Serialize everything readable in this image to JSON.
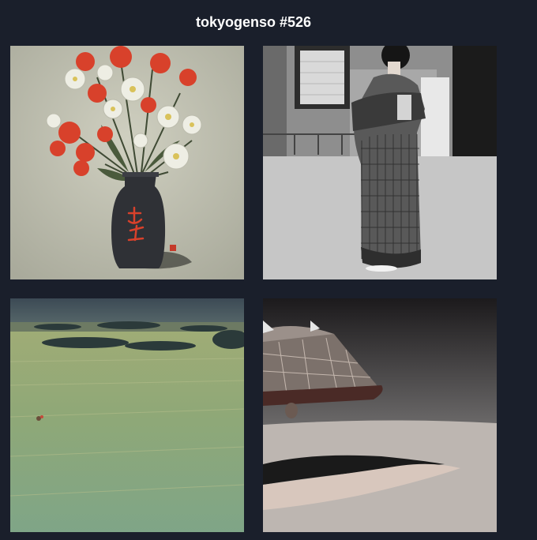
{
  "gallery": {
    "title": "tokyogenso #526",
    "images": [
      {
        "subject": "ikebana-vase-painting"
      },
      {
        "subject": "kimono-figure-photo"
      },
      {
        "subject": "green-field-landscape"
      },
      {
        "subject": "ufo-over-desert"
      }
    ]
  }
}
